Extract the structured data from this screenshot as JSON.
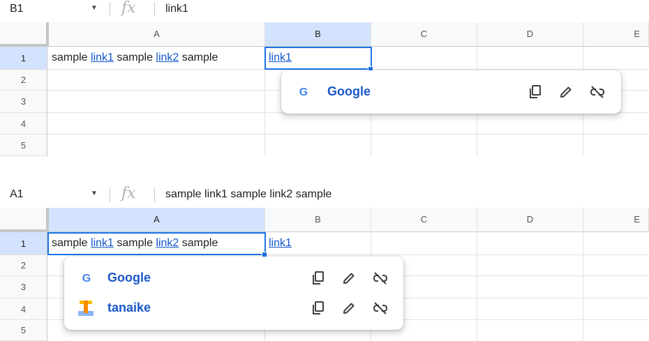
{
  "panels": [
    {
      "cell_ref": "B1",
      "formula": "link1",
      "columns": [
        "A",
        "B",
        "C",
        "D",
        "E"
      ],
      "rows": [
        "1",
        "2",
        "3",
        "4",
        "5"
      ],
      "cell_a1": {
        "s1": "sample ",
        "l1": "link1",
        "s2": " sample ",
        "l2": "link2",
        "s3": " sample"
      },
      "cell_b1": "link1",
      "popup": [
        {
          "title": "Google",
          "logo": "google-g-logo"
        }
      ]
    },
    {
      "cell_ref": "A1",
      "formula": "sample link1 sample link2 sample",
      "columns": [
        "A",
        "B",
        "C",
        "D",
        "E"
      ],
      "rows": [
        "1",
        "2",
        "3",
        "4",
        "5"
      ],
      "cell_a1": {
        "s1": "sample ",
        "l1": "link1",
        "s2": " sample ",
        "l2": "link2",
        "s3": " sample"
      },
      "cell_b1": "link1",
      "popup": [
        {
          "title": "Google",
          "logo": "google-g-logo"
        },
        {
          "title": "tanaike",
          "logo": "tanaike-t-logo"
        }
      ]
    }
  ],
  "icons": {
    "dropdown": "caret-down-icon",
    "fx": "fx-icon",
    "copy": "copy-link-icon",
    "edit": "edit-link-icon",
    "unlink": "remove-link-icon"
  },
  "colors": {
    "selection": "#1a73e8",
    "link": "#1155cc",
    "header_selected": "#d3e3fd"
  }
}
